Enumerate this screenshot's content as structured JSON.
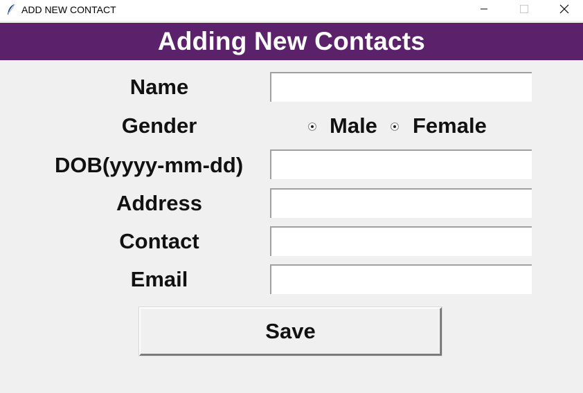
{
  "window": {
    "title": "ADD NEW CONTACT",
    "controls": {
      "minimize_icon": "minimize-icon",
      "maximize_icon": "maximize-icon",
      "close_icon": "close-icon"
    }
  },
  "header": {
    "title": "Adding New Contacts",
    "background_color": "#5b226b",
    "text_color": "#ffffff"
  },
  "form": {
    "name_label": "Name",
    "gender_label": "Gender",
    "gender_options": [
      {
        "label": "Male",
        "selected": false
      },
      {
        "label": "Female",
        "selected": false
      }
    ],
    "dob_label": "DOB(yyyy-mm-dd)",
    "address_label": "Address",
    "contact_label": "Contact",
    "email_label": "Email",
    "name_value": "",
    "dob_value": "",
    "address_value": "",
    "contact_value": "",
    "email_value": ""
  },
  "actions": {
    "save_label": "Save"
  }
}
